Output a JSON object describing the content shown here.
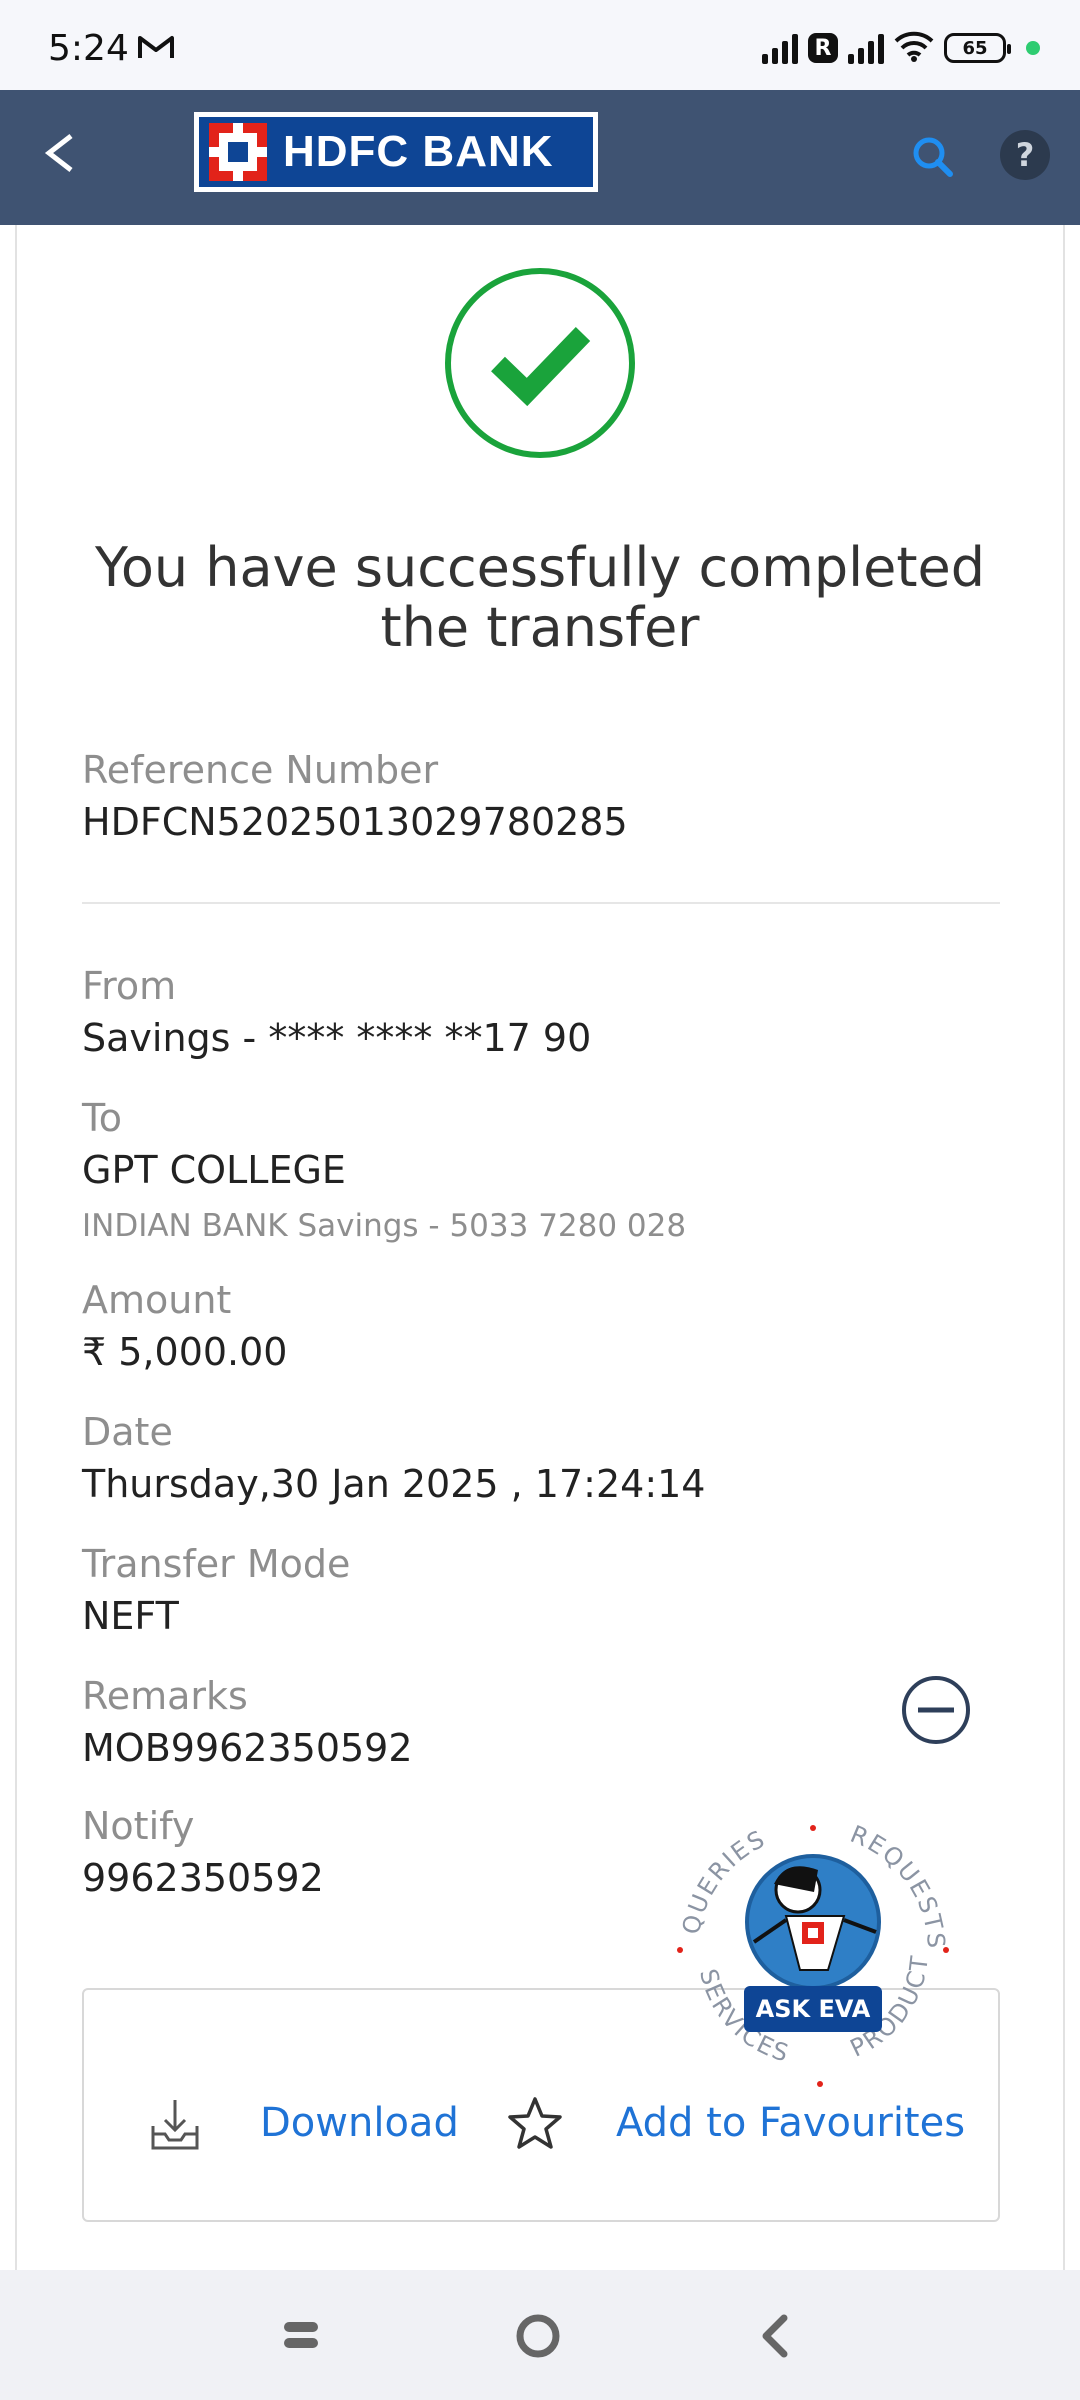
{
  "status": {
    "time": "5:24",
    "battery": "65",
    "network_badge": "R",
    "icons": [
      "gmail-icon",
      "signal-icon",
      "wifi-icon",
      "battery-icon"
    ]
  },
  "header": {
    "bank_name": "HDFC BANK",
    "back_icon": "chevron-left-icon",
    "search_icon": "search-icon",
    "help_label": "?",
    "colors": {
      "appbar": "#3f5372",
      "logo_blue": "#0e4595",
      "logo_red": "#e2231a",
      "search": "#1f8ef1"
    }
  },
  "confirmation": {
    "title": "You have successfully completed the transfer",
    "icon": "check-circle-icon",
    "color": "#1aa33b"
  },
  "details": {
    "reference_label": "Reference Number",
    "reference_value": "HDFCN52025013029780285",
    "from_label": "From",
    "from_value": "Savings - **** **** **17 90",
    "to_label": "To",
    "to_value": "GPT COLLEGE",
    "to_sub": "INDIAN BANK Savings - 5033 7280 028",
    "amount_label": "Amount",
    "amount_value": "₹ 5,000.00",
    "date_label": "Date",
    "date_value": "Thursday,30 Jan 2025 , 17:24:14",
    "mode_label": "Transfer Mode",
    "mode_value": "NEFT",
    "remarks_label": "Remarks",
    "remarks_value": "MOB9962350592",
    "notify_label": "Notify",
    "notify_value": "9962350592"
  },
  "eva": {
    "label": "ASK EVA",
    "ring_words": [
      "QUERIES",
      "REQUESTS",
      "PRODUCTS",
      "SERVICES"
    ]
  },
  "actions": {
    "download_label": "Download",
    "favourite_label": "Add to Favourites",
    "link_color": "#1f73d6"
  },
  "navbar": {
    "icons": [
      "recent-apps-icon",
      "home-icon",
      "back-icon"
    ]
  }
}
